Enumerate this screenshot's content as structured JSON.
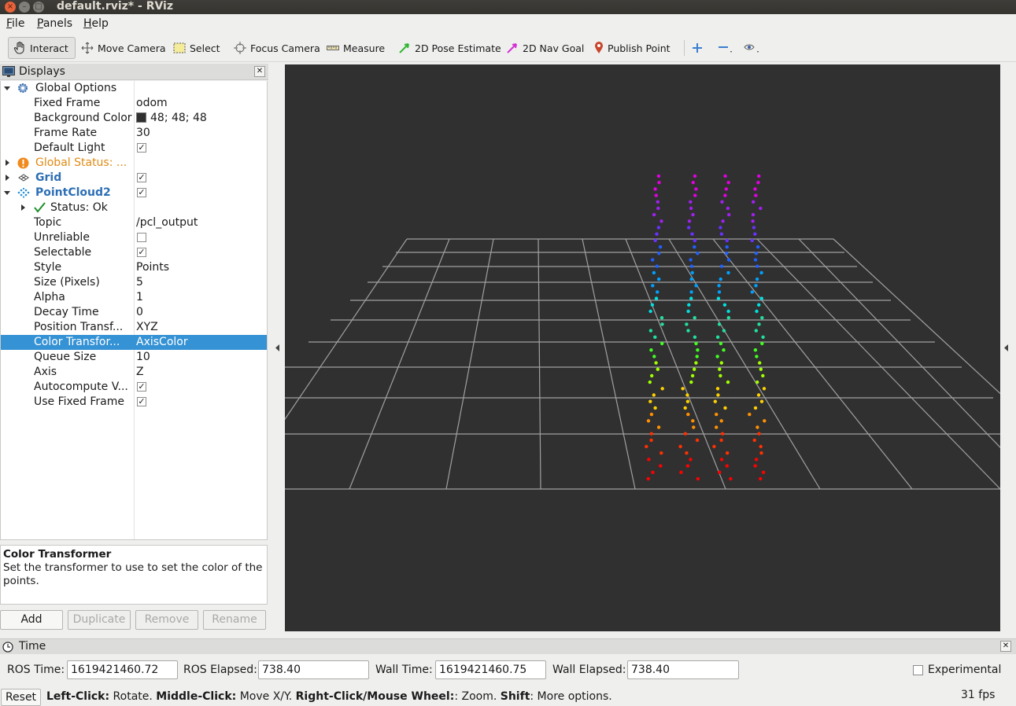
{
  "window": {
    "title": "default.rviz* - RViz"
  },
  "menu": {
    "file": "File",
    "panels": "Panels",
    "help": "Help"
  },
  "toolbar": {
    "interact": "Interact",
    "move_camera": "Move Camera",
    "select": "Select",
    "focus_camera": "Focus Camera",
    "measure": "Measure",
    "pose_estimate": "2D Pose Estimate",
    "nav_goal": "2D Nav Goal",
    "publish_point": "Publish Point"
  },
  "displays": {
    "title": "Displays",
    "global_options": "Global Options",
    "fixed_frame_label": "Fixed Frame",
    "fixed_frame_value": "odom",
    "background_color_label": "Background Color",
    "background_color_value": "48; 48; 48",
    "frame_rate_label": "Frame Rate",
    "frame_rate_value": "30",
    "default_light_label": "Default Light",
    "global_status": "Global Status: ...",
    "grid": "Grid",
    "pointcloud": "PointCloud2",
    "status_ok": "Status: Ok",
    "topic_label": "Topic",
    "topic_value": "/pcl_output",
    "unreliable_label": "Unreliable",
    "selectable_label": "Selectable",
    "style_label": "Style",
    "style_value": "Points",
    "size_label": "Size (Pixels)",
    "size_value": "5",
    "alpha_label": "Alpha",
    "alpha_value": "1",
    "decay_label": "Decay Time",
    "decay_value": "0",
    "position_label": "Position Transf...",
    "position_value": "XYZ",
    "color_label": "Color Transfor...",
    "color_value": "AxisColor",
    "queue_label": "Queue Size",
    "queue_value": "10",
    "axis_label": "Axis",
    "axis_value": "Z",
    "autocompute_label": "Autocompute V...",
    "fixed_frame_use_label": "Use Fixed Frame"
  },
  "description": {
    "title": "Color Transformer",
    "text": "Set the transformer to use to set the color of the points."
  },
  "buttons": {
    "add": "Add",
    "duplicate": "Duplicate",
    "remove": "Remove",
    "rename": "Rename"
  },
  "time": {
    "title": "Time",
    "ros_time_label": "ROS Time:",
    "ros_time_value": "1619421460.72",
    "ros_elapsed_label": "ROS Elapsed:",
    "ros_elapsed_value": "738.40",
    "wall_time_label": "Wall Time:",
    "wall_time_value": "1619421460.75",
    "wall_elapsed_label": "Wall Elapsed:",
    "wall_elapsed_value": "738.40",
    "experimental": "Experimental"
  },
  "status": {
    "reset": "Reset",
    "left_click": "Left-Click:",
    "left_click_desc": " Rotate. ",
    "middle_click": "Middle-Click:",
    "middle_click_desc": " Move X/Y. ",
    "right_click": "Right-Click/Mouse Wheel:",
    "right_click_desc": ": Zoom. ",
    "shift": "Shift",
    "shift_desc": ": More options.",
    "fps": "31 fps"
  },
  "colors": {
    "background": "#303030",
    "selection": "#3592d4",
    "grid": "#a0a0a0"
  }
}
